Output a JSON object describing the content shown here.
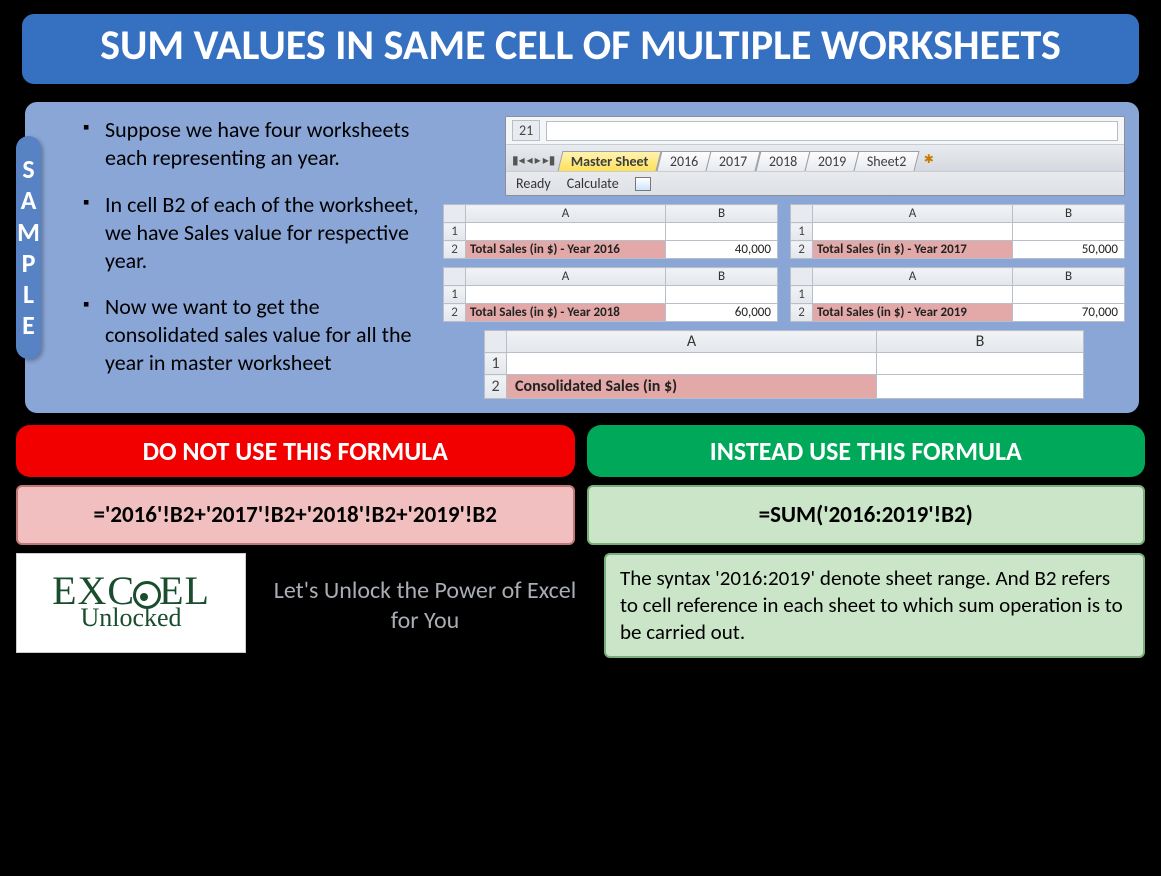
{
  "title": "SUM VALUES IN SAME CELL OF MULTIPLE WORKSHEETS",
  "sample_tab": [
    "S",
    "A",
    "M",
    "P",
    "L",
    "E"
  ],
  "bullets": [
    "Suppose we have four worksheets each representing an year.",
    "In cell B2 of each of the worksheet, we have Sales value for respective year.",
    "Now we want to get the consolidated sales value for all the year in master worksheet"
  ],
  "xl": {
    "row_number": "21",
    "tabs": [
      "Master Sheet",
      "2016",
      "2017",
      "2018",
      "2019",
      "Sheet2"
    ],
    "active_tab": "Master Sheet",
    "status": [
      "Ready",
      "Calculate"
    ]
  },
  "mini": [
    {
      "label": "Total Sales (in $) - Year 2016",
      "value": "40,000"
    },
    {
      "label": "Total Sales (in $) - Year 2017",
      "value": "50,000"
    },
    {
      "label": "Total Sales (in $) - Year 2018",
      "value": "60,000"
    },
    {
      "label": "Total Sales (in $) - Year 2019",
      "value": "70,000"
    }
  ],
  "master": {
    "label": "Consolidated Sales (in $)",
    "value": ""
  },
  "col_a": "A",
  "col_b": "B",
  "formulas": {
    "dont_header": "DO NOT USE THIS FORMULA",
    "instead_header": "INSTEAD USE THIS FORMULA",
    "dont_code": "='2016'!B2+'2017'!B2+'2018'!B2+'2019'!B2",
    "instead_code": "=SUM('2016:2019'!B2)"
  },
  "footer": {
    "logo_top": "EXC   EL",
    "logo_bottom": "Unlocked",
    "tagline": "Let's Unlock the Power of Excel for You",
    "explain": "The syntax '2016:2019' denote sheet range. And B2 refers to cell reference in each sheet to which sum operation is to be carried out."
  }
}
